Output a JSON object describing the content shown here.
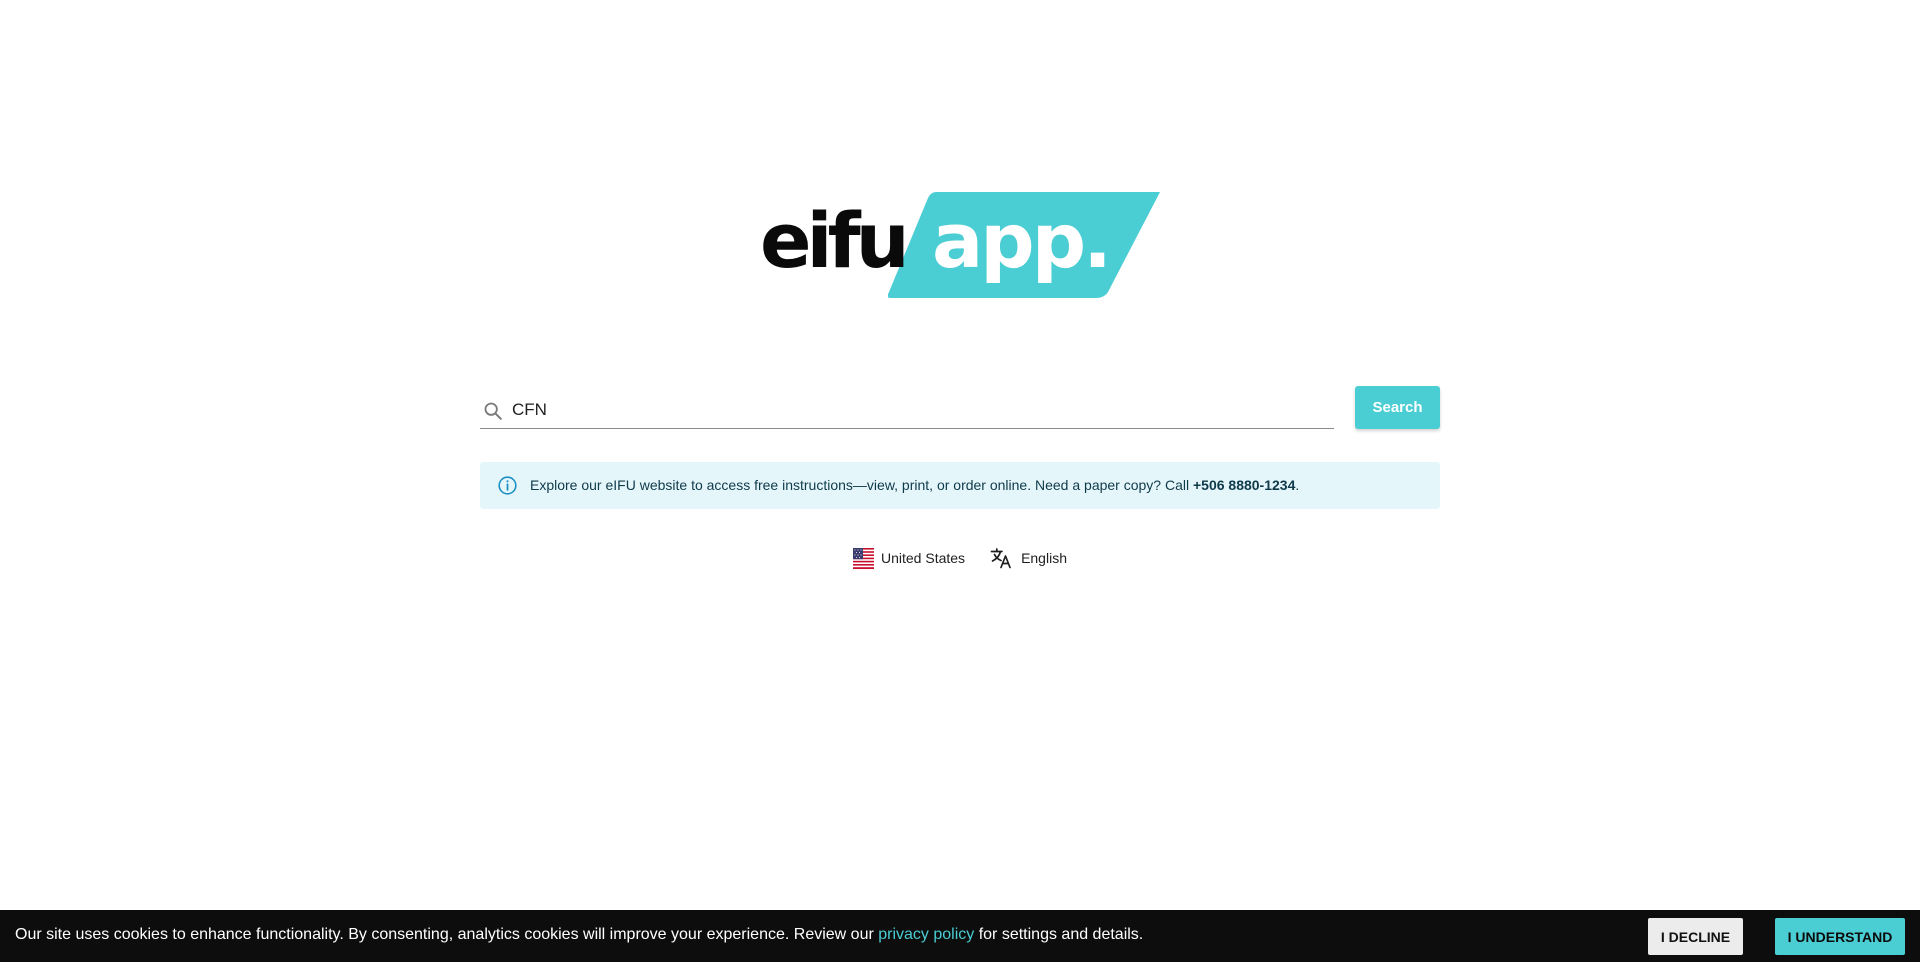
{
  "logo": {
    "left_word": "eifu",
    "right_word": "app.",
    "badge_color": "#4acdd3"
  },
  "search": {
    "icon": "search-icon",
    "value": "CFN",
    "placeholder": "",
    "button_label": "Search"
  },
  "info": {
    "icon": "info-icon",
    "text": "Explore our eIFU website to access free instructions—view, print, or order online. Need a paper copy? Call ",
    "phone": "+506 8880-1234",
    "suffix": "."
  },
  "locale": {
    "country_flag_icon": "us-flag-icon",
    "country": "United States",
    "language_icon": "translate-icon",
    "language": "English"
  },
  "cookie": {
    "text_before": "Our site uses cookies to enhance functionality. By consenting, analytics cookies will improve your experience. Review our ",
    "link": "privacy policy",
    "text_after": " for settings and details.",
    "decline_label": "I DECLINE",
    "accept_label": "I UNDERSTAND"
  },
  "colors": {
    "accent": "#4acdd3",
    "info_bg": "#e5f6fb",
    "cookie_bg": "#0d0d0d"
  }
}
